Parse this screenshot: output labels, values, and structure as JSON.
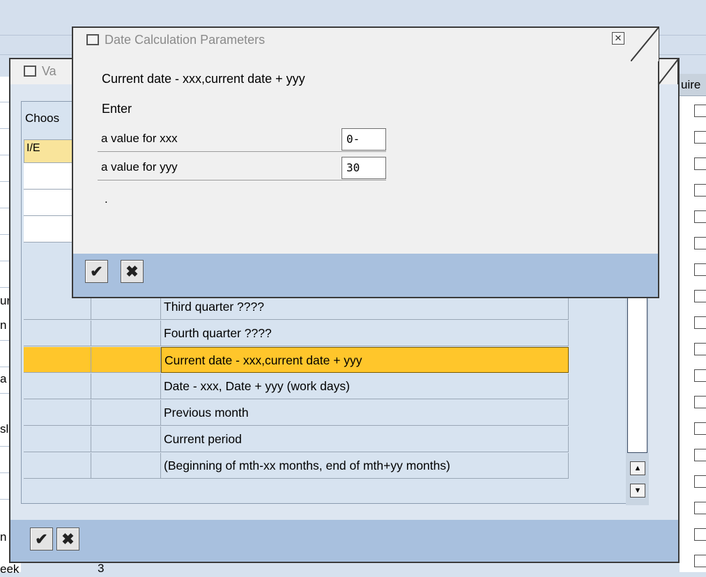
{
  "background": {
    "cut_labels": [
      "ur",
      "n",
      "a",
      "sll",
      "n",
      "eek"
    ],
    "right_header": "uire",
    "bottom_cell": "3"
  },
  "value_dialog": {
    "title": "Va",
    "choose_label": "Choos",
    "column_header": "I/E",
    "rows": [
      {
        "label": "Third quarter ????",
        "selected": false
      },
      {
        "label": "Fourth quarter ????",
        "selected": false
      },
      {
        "label": "Current date - xxx,current date + yyy",
        "selected": true
      },
      {
        "label": "Date - xxx, Date + yyy (work days)",
        "selected": false
      },
      {
        "label": "Previous month",
        "selected": false
      },
      {
        "label": "Current period",
        "selected": false
      },
      {
        "label": "(Beginning of mth-xx months, end of mth+yy months)",
        "selected": false
      }
    ],
    "scroll_up": "▲",
    "scroll_down": "▼",
    "ok_glyph": "✔",
    "cancel_glyph": "✖"
  },
  "date_dialog": {
    "title": "Date Calculation Parameters",
    "close_glyph": "✕",
    "line1": "Current date - xxx,current date + yyy",
    "line2": "Enter",
    "params": [
      {
        "label": "a value for xxx",
        "value": "0-"
      },
      {
        "label": "a value for yyy",
        "value": "30"
      }
    ],
    "trailing": ".",
    "ok_glyph": "✔",
    "cancel_glyph": "✖"
  },
  "colors": {
    "selection": "#ffc62b",
    "footer": "#a8c0de",
    "header_cell": "#f9e49b"
  }
}
